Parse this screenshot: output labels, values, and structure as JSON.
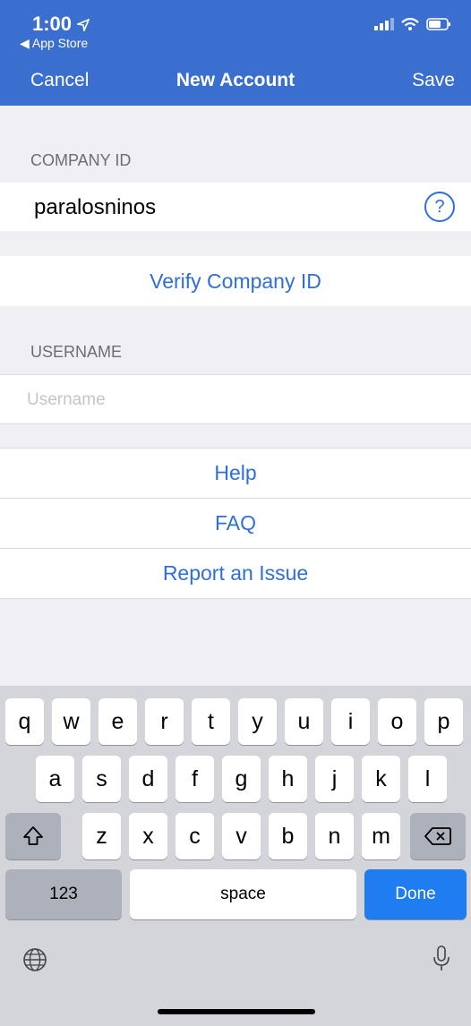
{
  "status_bar": {
    "time": "1:00",
    "back_label": "◀ App Store"
  },
  "nav": {
    "cancel": "Cancel",
    "title": "New Account",
    "save": "Save"
  },
  "company_section": {
    "header": "COMPANY ID",
    "value": "paralosninos",
    "help_symbol": "?"
  },
  "verify_label": "Verify Company ID",
  "username_section": {
    "header": "USERNAME",
    "placeholder": "Username"
  },
  "links": [
    "Help",
    "FAQ",
    "Report an Issue"
  ],
  "keyboard": {
    "row1": [
      "q",
      "w",
      "e",
      "r",
      "t",
      "y",
      "u",
      "i",
      "o",
      "p"
    ],
    "row2": [
      "a",
      "s",
      "d",
      "f",
      "g",
      "h",
      "j",
      "k",
      "l"
    ],
    "row3": [
      "z",
      "x",
      "c",
      "v",
      "b",
      "n",
      "m"
    ],
    "numbers_key": "123",
    "space_key": "space",
    "done_key": "Done"
  },
  "colors": {
    "bar": "#3a6fcf",
    "accent": "#2f6fd6",
    "done": "#1f7cf1"
  },
  "icons": [
    "location-arrow-icon",
    "signal-icon",
    "wifi-icon",
    "battery-icon",
    "help-circle-icon",
    "shift-icon",
    "backspace-icon",
    "globe-icon",
    "microphone-icon"
  ]
}
